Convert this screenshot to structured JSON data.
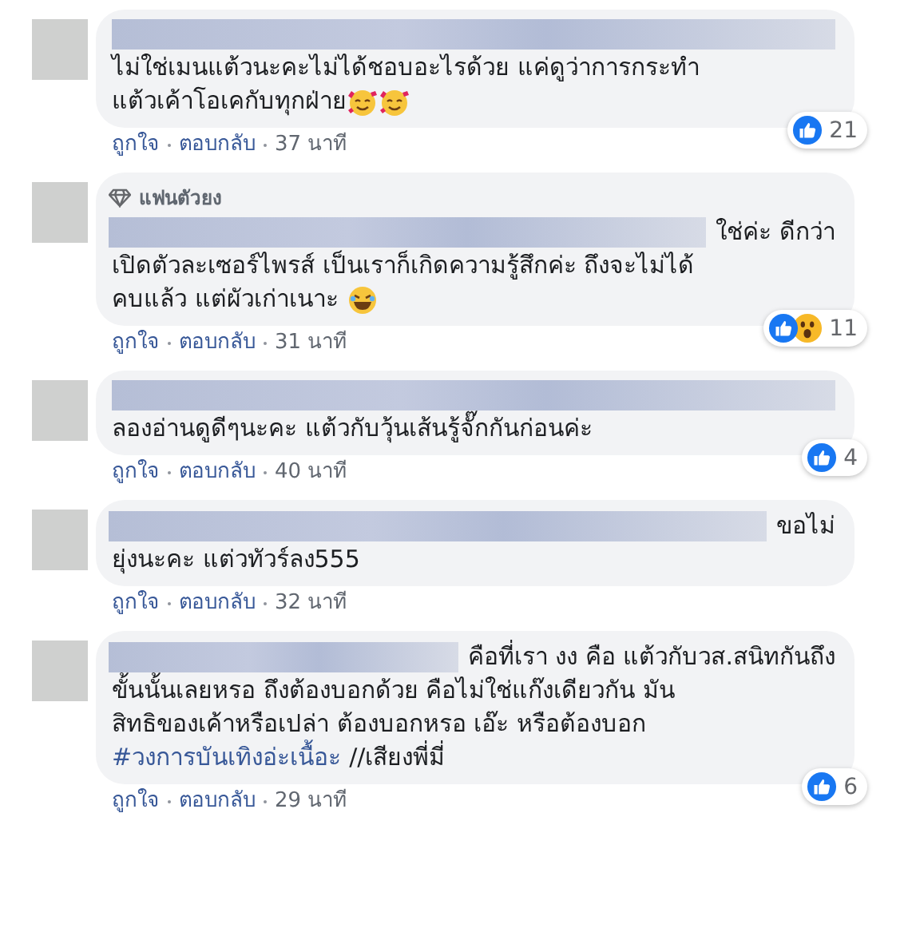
{
  "comments": [
    {
      "lines": [
        "ไม่ใช่เมนแต้วนะคะไม่ได้ชอบอะไรด้วย แค่ดูว่าการกระทำ",
        "แต้วเค้าโอเคกับทุกฝ่าย"
      ],
      "emojis": [
        {
          "kind": "hearts-face"
        },
        {
          "kind": "hearts-face"
        }
      ],
      "reactions": [
        {
          "kind": "like"
        }
      ],
      "count": "21",
      "actions": [
        "ถูกใจ",
        "ตอบกลับ"
      ],
      "time": "37 นาที"
    },
    {
      "badge": {
        "label": "แฟนตัวยง"
      },
      "lead": "ใช่ค่ะ ดีกว่า",
      "lines": [
        "เปิดตัวละเซอร์ไพรส์ เป็นเราก็เกิดความรู้สึกค่ะ ถึงจะไม่ได้",
        "คบแล้ว แต่ผัวเก่าเนาะ"
      ],
      "emojis": [
        {
          "kind": "laughing-face"
        }
      ],
      "reactions": [
        {
          "kind": "like"
        },
        {
          "kind": "wow"
        }
      ],
      "count": "11",
      "actions": [
        "ถูกใจ",
        "ตอบกลับ"
      ],
      "time": "31 นาที"
    },
    {
      "lines": [
        "ลองอ่านดูดีๆนะคะ แต้วกับวุ้นเส้นรู้จั๊กกันก่อนค่ะ"
      ],
      "reactions": [
        {
          "kind": "like"
        }
      ],
      "count": "4",
      "actions": [
        "ถูกใจ",
        "ตอบกลับ"
      ],
      "time": "40 นาที"
    },
    {
      "lead": "ขอไม่",
      "lines": [
        "ยุ่งนะคะ แต่วทัวร์ลง555"
      ],
      "actions": [
        "ถูกใจ",
        "ตอบกลับ"
      ],
      "time": "32 นาที"
    },
    {
      "lead": "คือที่เรา งง คือ แต้วกับวส.สนิทกันถึง",
      "lines": [
        "ขั้นนั้นเลยหรอ ถึงต้องบอกด้วย คือไม่ใช่แก๊งเดียวกัน มัน",
        "สิทธิของเค้าหรือเปล่า ต้องบอกหรอ เอ๊ะ หรือต้องบอก"
      ],
      "link": {
        "text": "#วงการบันเทิงอ่ะเนื้อะ",
        "after": "//เสียงพี่มี่"
      },
      "reactions": [
        {
          "kind": "like"
        }
      ],
      "count": "6",
      "actions": [
        "ถูกใจ",
        "ตอบกลับ"
      ],
      "time": "29 นาที"
    }
  ]
}
